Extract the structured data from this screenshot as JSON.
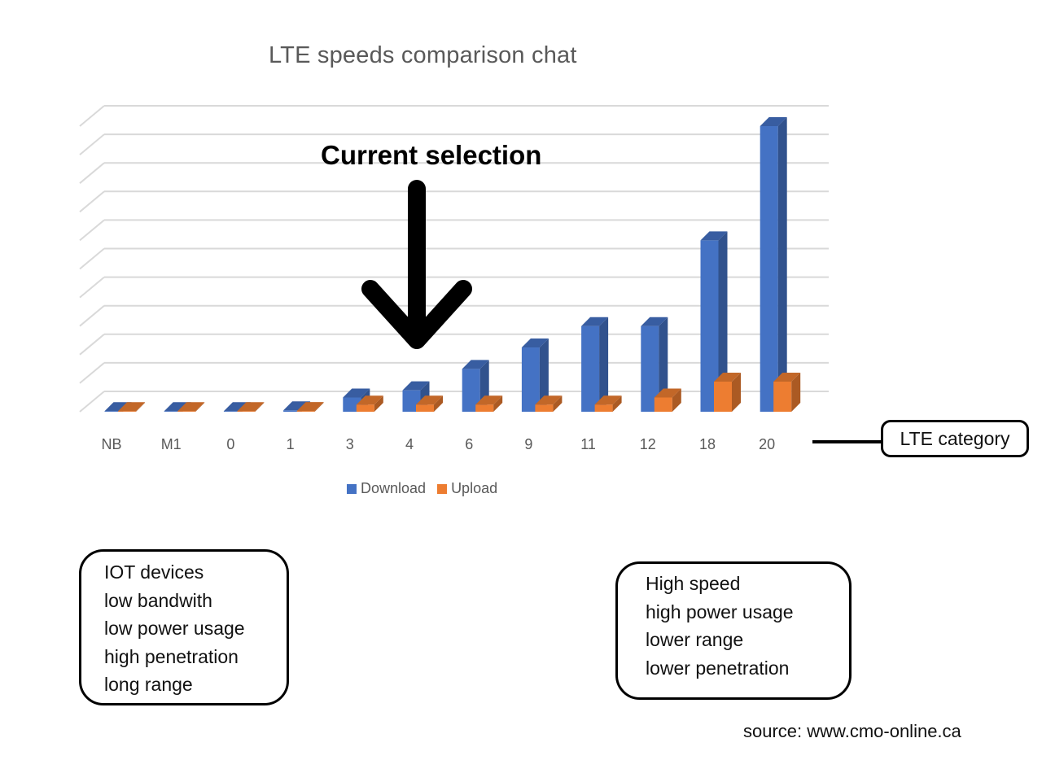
{
  "chart_data": {
    "type": "bar",
    "title": "LTE speeds comparison chat",
    "xlabel": "LTE category",
    "ylabel": "",
    "categories": [
      "NB",
      "M1",
      "0",
      "1",
      "3",
      "4",
      "6",
      "9",
      "11",
      "12",
      "18",
      "20"
    ],
    "series": [
      {
        "name": "Download",
        "color": "#4472C4",
        "values": [
          0.2,
          1,
          1,
          10,
          100,
          150,
          300,
          450,
          600,
          600,
          1200,
          2000
        ]
      },
      {
        "name": "Upload",
        "color": "#ED7D31",
        "values": [
          0.1,
          1,
          1,
          5,
          50,
          50,
          50,
          50,
          50,
          100,
          211,
          211
        ]
      }
    ],
    "ylim": [
      0,
      2000
    ],
    "y_gridline_step": 200,
    "y_tick_labels_visible": false,
    "grid": true,
    "legend": "bottom",
    "style": "3d-clustered-column"
  },
  "annotation": {
    "label": "Current selection",
    "points_to_category": "4"
  },
  "callout": {
    "label": "LTE category"
  },
  "info_left": {
    "lines": [
      "IOT devices",
      "low bandwith",
      "low power usage",
      "high penetration",
      "long range"
    ]
  },
  "info_right": {
    "lines": [
      "High speed",
      "high power usage",
      "lower range",
      "lower penetration"
    ]
  },
  "source": "source: www.cmo-online.ca"
}
